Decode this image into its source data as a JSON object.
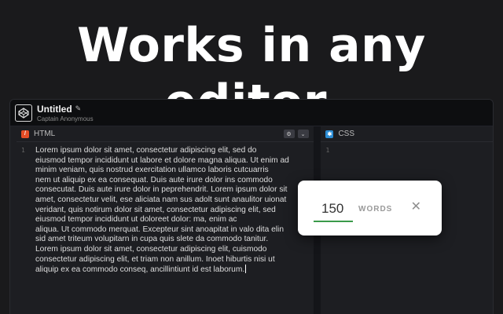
{
  "headline": "Works in any editor.",
  "window": {
    "title": "Untitled",
    "pencil_icon": "✎",
    "author": "Captain Anonymous",
    "logo_icon": "codepen-logo-icon"
  },
  "panes": {
    "html": {
      "title": "HTML",
      "badge_color": "#e44d26",
      "badge_glyph": "/",
      "settings_icon": "⚙",
      "collapse_icon": "⌄",
      "line_number": "1",
      "lines": [
        "Lorem ipsum dolor sit amet, consectetur adipiscing elit, sed do",
        "eiusmod tempor incididunt ut labore et dolore magna aliqua. Ut enim ad",
        "minim veniam, quis nostrud exercitation ullamco laboris cutcuarris",
        "nem ut aliquip ex ea consequat. Duis aute irure dolor ins commodo",
        "consecutat. Duis aute irure dolor in peprehendrit. Lorem ipsum dolor sit",
        "amet, consectetur velit, ese aliciata nam sus adolt sunt anaulitor uionat",
        "veridant, quis notirum dolor sit amet, consectetur adipiscing elit, sed",
        "eiusmod tempor incididunt ut doloreet dolor: ma, enim ac",
        "aliqua. Ut commodo merquat. Excepteur sint anoapitat in valo dita elin",
        "sid amet triteum volupitarn in cupa quis slete da commodo tanitur.",
        "Lorem ipsum dolor sit amet, consectetur adipiscing elit, cuismodo",
        "consectetur adipiscing elit, et triam non anillum. Inoet hiburtis nisi ut",
        "aliquip ex ea commodo conseq, ancillintiunt id est laborum."
      ]
    },
    "css": {
      "title": "CSS",
      "badge_color": "#2d8ed6",
      "badge_glyph": "✱",
      "line_number": "1"
    }
  },
  "word_count": {
    "value": "150",
    "label": "WORDS",
    "close_glyph": "✕",
    "accent_color": "#3a9a4a"
  }
}
